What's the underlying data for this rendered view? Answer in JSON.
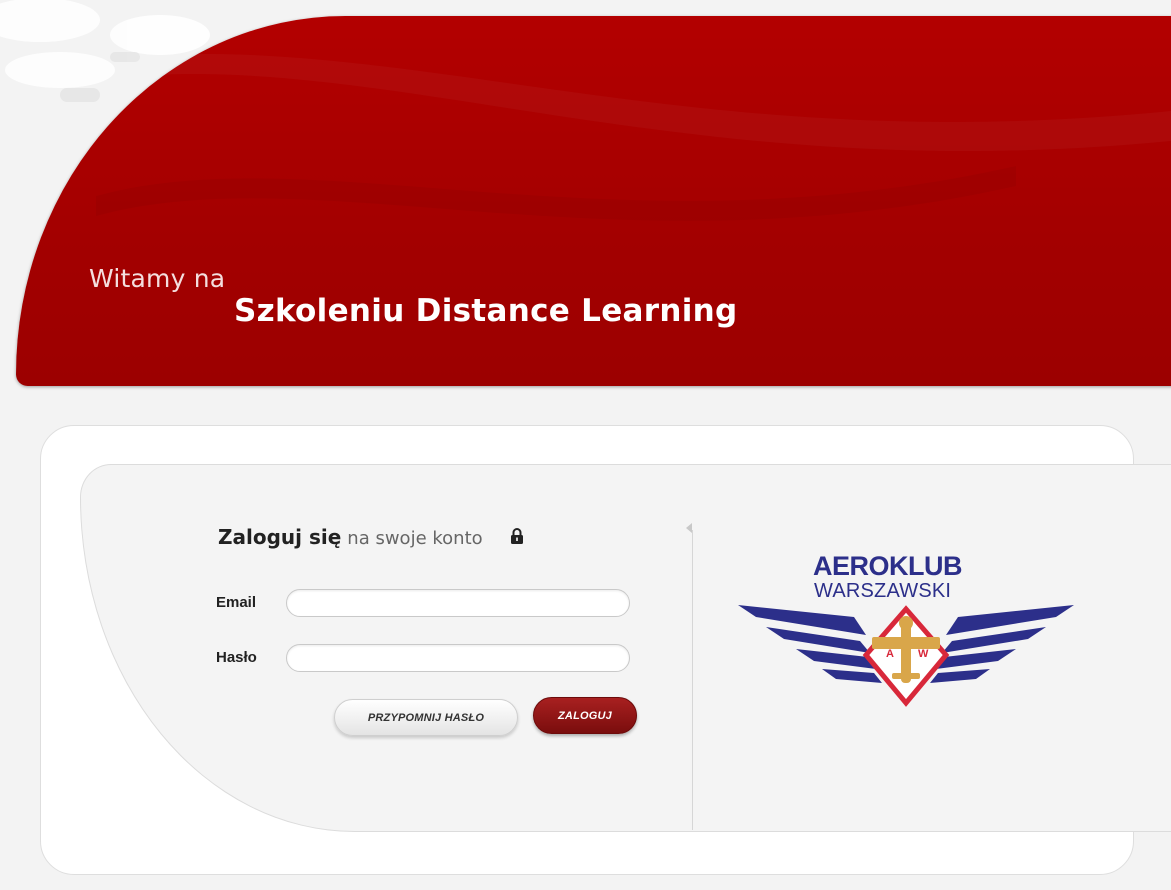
{
  "banner": {
    "welcome": "Witamy na",
    "title": "Szkoleniu Distance Learning"
  },
  "login": {
    "heading_strong": "Zaloguj się",
    "heading_light": "na swoje konto",
    "email_label": "Email",
    "email_value": "",
    "password_label": "Hasło",
    "password_value": "",
    "remind_label": "PRZYPOMNIJ HASŁO",
    "login_label": "ZALOGUJ"
  },
  "logo": {
    "name": "AEROKLUB",
    "sub": "WARSZAWSKI",
    "emblem_letters": "A W"
  },
  "colors": {
    "brand_red": "#a30000",
    "logo_blue": "#2c2f8a",
    "logo_red": "#d8283a",
    "logo_gold": "#d9a64a"
  },
  "icons": {
    "lock": "lock-icon"
  }
}
